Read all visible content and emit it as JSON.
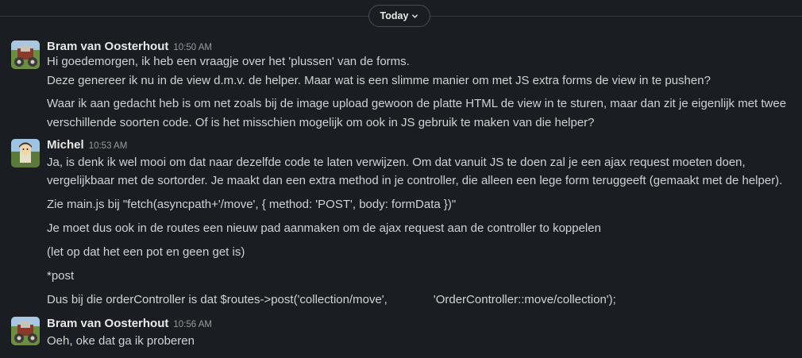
{
  "day_divider": {
    "label": "Today"
  },
  "messages": [
    {
      "author": "Bram van Oosterhout",
      "time": "10:50 AM",
      "lines": [
        "Hi goedemorgen, ik heb een vraagje over het 'plussen' van de forms.",
        "Deze genereer ik nu in de view d.m.v. de helper. Maar wat is een slimme manier om met JS extra forms de view in te pushen?",
        "Waar ik aan gedacht heb is om net zoals bij de image upload gewoon de platte HTML de view in te sturen, maar dan zit je eigenlijk met twee",
        "verschillende soorten code. Of is het misschien mogelijk om ook in JS gebruik te maken van die helper?"
      ]
    },
    {
      "author": "Michel",
      "time": "10:53 AM",
      "lines": [
        "Ja, is denk ik wel mooi om dat naar dezelfde code te laten verwijzen. Om dat vanuit JS te doen zal je een ajax request moeten doen,",
        "vergelijkbaar met de sortorder. Je maakt dan een extra method in je controller, die alleen een lege form teruggeeft (gemaakt met de helper).",
        "Zie main.js bij \"fetch(asyncpath+'/move', { method: 'POST', body: formData })\"",
        "Je moet dus ook in de routes een nieuw pad aanmaken om de ajax request aan de controller to koppelen",
        "(let op dat het een pot en geen get is)",
        "*post",
        "Dus bij die orderController is dat $routes->post('collection/move',",
        "'OrderController::move/collection');"
      ]
    },
    {
      "author": "Bram van Oosterhout",
      "time": "10:56 AM",
      "lines": [
        "Oeh, oke dat ga ik proberen"
      ]
    }
  ]
}
